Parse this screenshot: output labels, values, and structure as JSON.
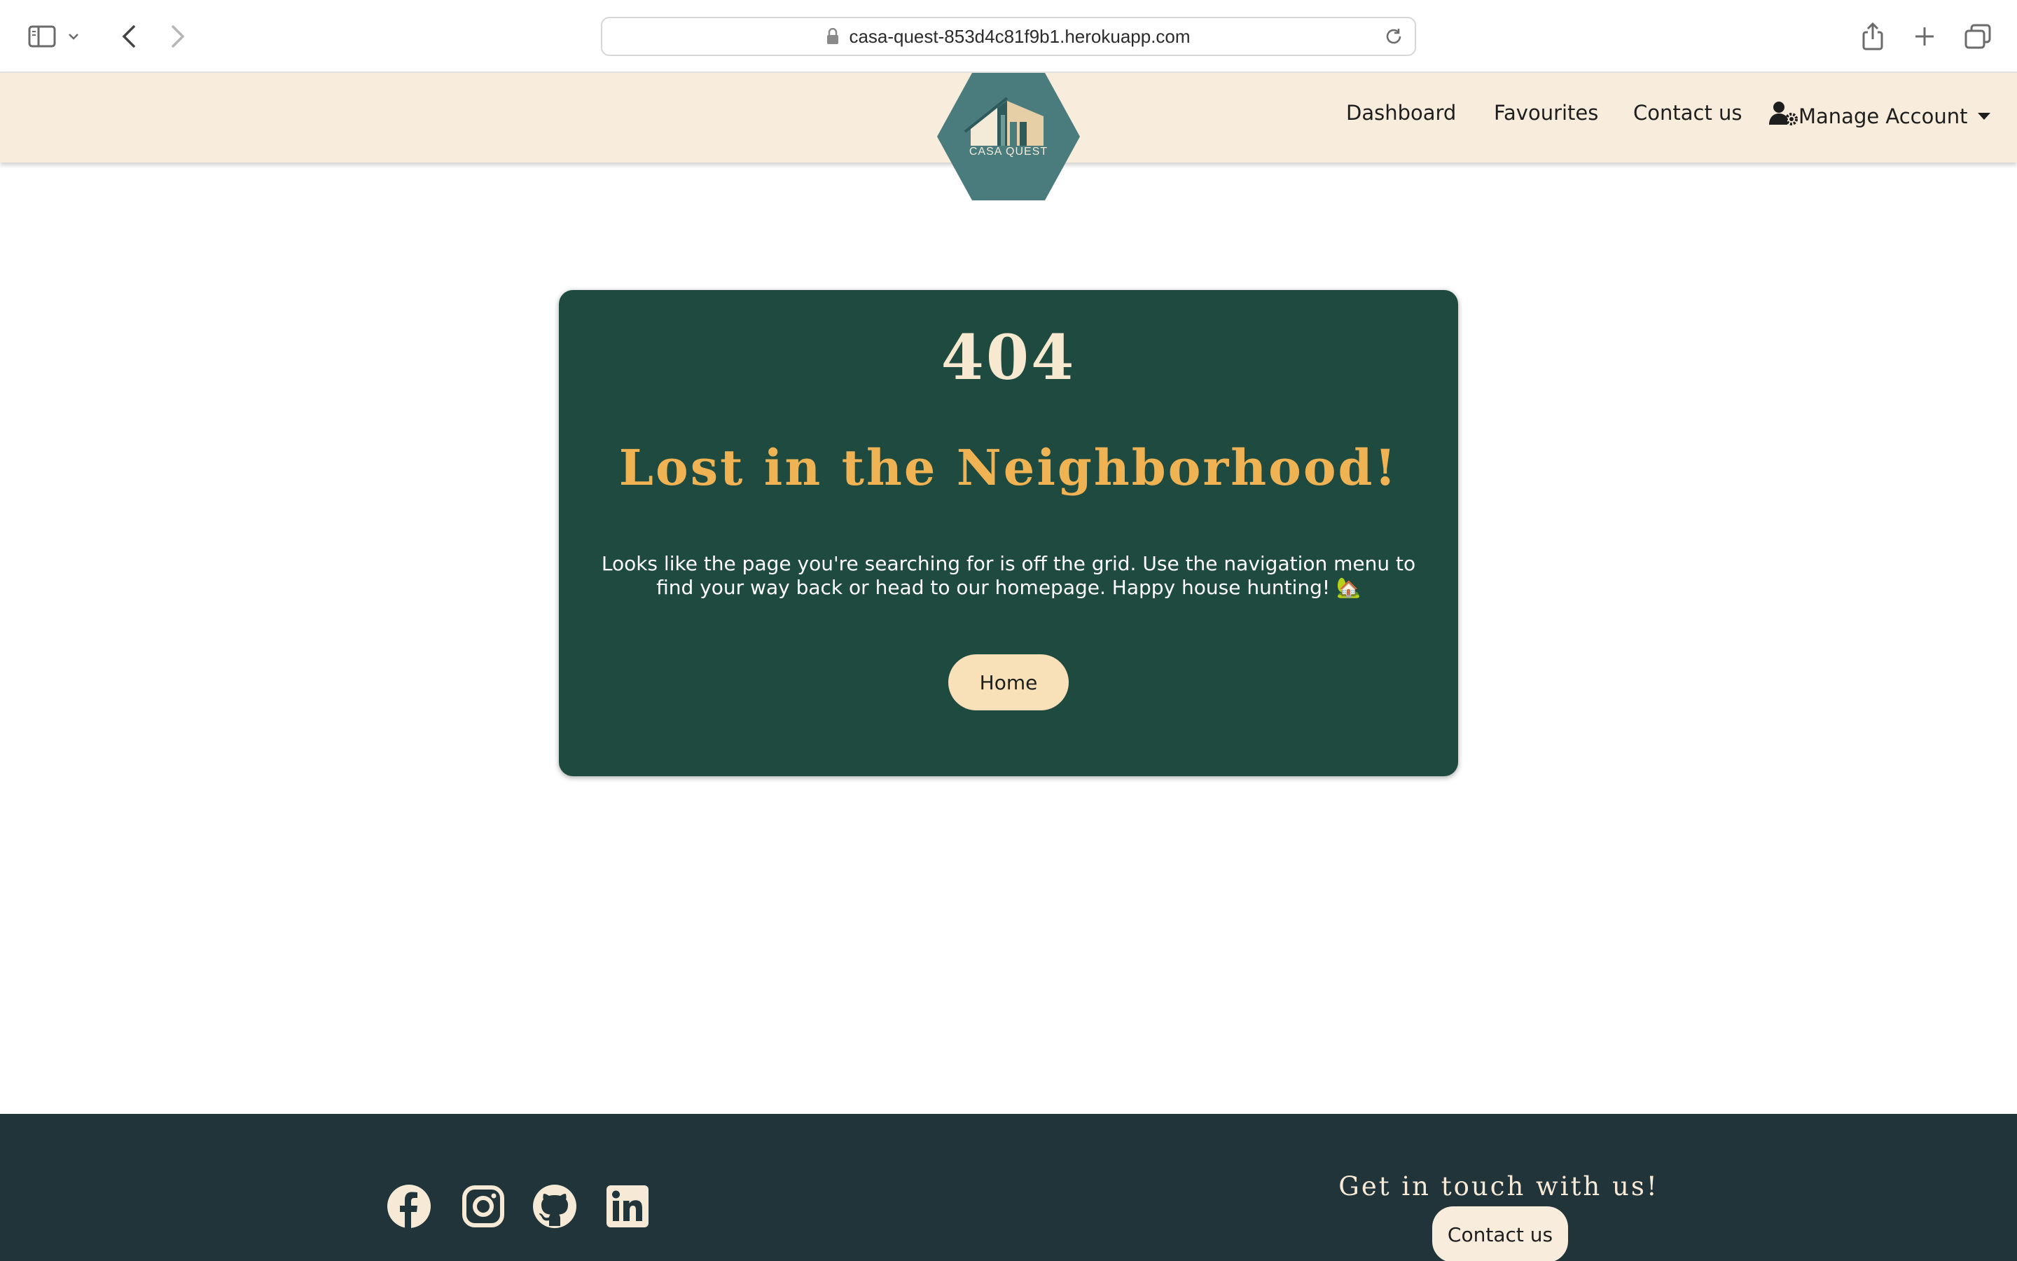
{
  "browser": {
    "url": "casa-quest-853d4c81f9b1.herokuapp.com"
  },
  "header": {
    "logo_text": "CASA QUEST",
    "nav": {
      "dashboard": "Dashboard",
      "favourites": "Favourites",
      "contact": "Contact us",
      "account": "Manage Account"
    }
  },
  "error": {
    "code": "404",
    "headline": "Lost in the Neighborhood!",
    "message": "Looks like the page you're searching for is off the grid. Use the navigation menu to find your way back or head to our homepage. Happy house hunting! 🏡",
    "home_button": "Home"
  },
  "footer": {
    "social": [
      "facebook-icon",
      "instagram-icon",
      "github-icon",
      "linkedin-icon"
    ],
    "touch_heading": "Get in touch with us!",
    "contact_button": "Contact us"
  },
  "colors": {
    "header_bg": "#f8ecdc",
    "logo_hex": "#4a7c7e",
    "card_bg": "#1f4a40",
    "code": "#f6e9cf",
    "headline": "#f0b354",
    "button_bg": "#f8e1b9",
    "footer_bg": "#21343a"
  }
}
